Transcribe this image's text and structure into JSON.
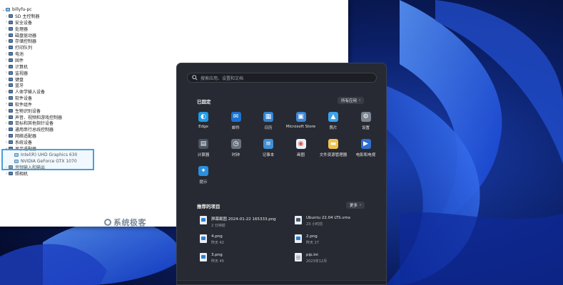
{
  "device_manager": {
    "root": "billyfu-pc",
    "categories": [
      {
        "label": "SD 主控制器",
        "expanded": false
      },
      {
        "label": "安全设备",
        "expanded": false
      },
      {
        "label": "处理器",
        "expanded": false
      },
      {
        "label": "磁盘驱动器",
        "expanded": false
      },
      {
        "label": "存储控制器",
        "expanded": false
      },
      {
        "label": "打印队列",
        "expanded": false
      },
      {
        "label": "电池",
        "expanded": false
      },
      {
        "label": "固件",
        "expanded": false
      },
      {
        "label": "计算机",
        "expanded": false
      },
      {
        "label": "监视器",
        "expanded": false
      },
      {
        "label": "键盘",
        "expanded": false
      },
      {
        "label": "蓝牙",
        "expanded": false
      },
      {
        "label": "人体学输入设备",
        "expanded": false
      },
      {
        "label": "软件设备",
        "expanded": false
      },
      {
        "label": "软件组件",
        "expanded": false
      },
      {
        "label": "生物识别设备",
        "expanded": false
      },
      {
        "label": "声音、视频和游戏控制器",
        "expanded": false
      },
      {
        "label": "鼠标和其他指针设备",
        "expanded": false
      },
      {
        "label": "通用串行总线控制器",
        "expanded": false
      },
      {
        "label": "网络适配器",
        "expanded": false
      },
      {
        "label": "系统设备",
        "expanded": false
      },
      {
        "label": "显示适配器",
        "expanded": true
      },
      {
        "label": "Intel(R) UHD Graphics 630",
        "child": true
      },
      {
        "label": "NVIDIA GeForce GTX 1070",
        "child": true
      },
      {
        "label": "音频输入和输出",
        "expanded": false
      },
      {
        "label": "照相机",
        "expanded": false
      }
    ],
    "watermark": "系统极客"
  },
  "start_menu": {
    "search_placeholder": "搜索应用、设置和文档",
    "pinned_title": "已固定",
    "all_apps_label": "所有应用",
    "pinned_apps": [
      {
        "label": "Edge",
        "icon": "edge-icon",
        "color": "#1f9be6"
      },
      {
        "label": "邮件",
        "icon": "mail-icon",
        "color": "#1b72d1"
      },
      {
        "label": "日历",
        "icon": "calendar-icon",
        "color": "#2f85d6"
      },
      {
        "label": "Microsoft Store",
        "icon": "store-icon",
        "color": "#3a86d8"
      },
      {
        "label": "照片",
        "icon": "photos-icon",
        "color": "#3da2e8"
      },
      {
        "label": "设置",
        "icon": "settings-icon",
        "color": "#7c8591"
      },
      {
        "label": "计算器",
        "icon": "calculator-icon",
        "color": "#4b5563"
      },
      {
        "label": "时钟",
        "icon": "clock-icon",
        "color": "#6b7380"
      },
      {
        "label": "记事本",
        "icon": "notepad-icon",
        "color": "#3f8fd8"
      },
      {
        "label": "画图",
        "icon": "paint-icon",
        "color": "#e9f1fb"
      },
      {
        "label": "文件资源管理器",
        "icon": "folder-icon",
        "color": "#f2c14e"
      },
      {
        "label": "电影和电视",
        "icon": "movies-icon",
        "color": "#2f6fd0"
      },
      {
        "label": "提示",
        "icon": "tips-icon",
        "color": "#2b8ee0"
      }
    ],
    "recommended_title": "推荐的项目",
    "more_label": "更多",
    "recommended": [
      {
        "name": "屏幕截图 2024-01-22 165333.png",
        "time": "2 分钟前",
        "icon": "image-file-icon"
      },
      {
        "name": "Ubuntu 22.04 LTS.vmx",
        "time": "23 小时前",
        "icon": "vmx-file-icon"
      },
      {
        "name": "4.png",
        "time": "昨天 42",
        "icon": "image-file-icon"
      },
      {
        "name": "2.png",
        "time": "昨天 27",
        "icon": "image-file-icon"
      },
      {
        "name": "3.png",
        "time": "昨天 45",
        "icon": "image-file-icon"
      },
      {
        "name": "pip.ini",
        "time": "2023年12月",
        "icon": "text-file-icon"
      }
    ]
  }
}
